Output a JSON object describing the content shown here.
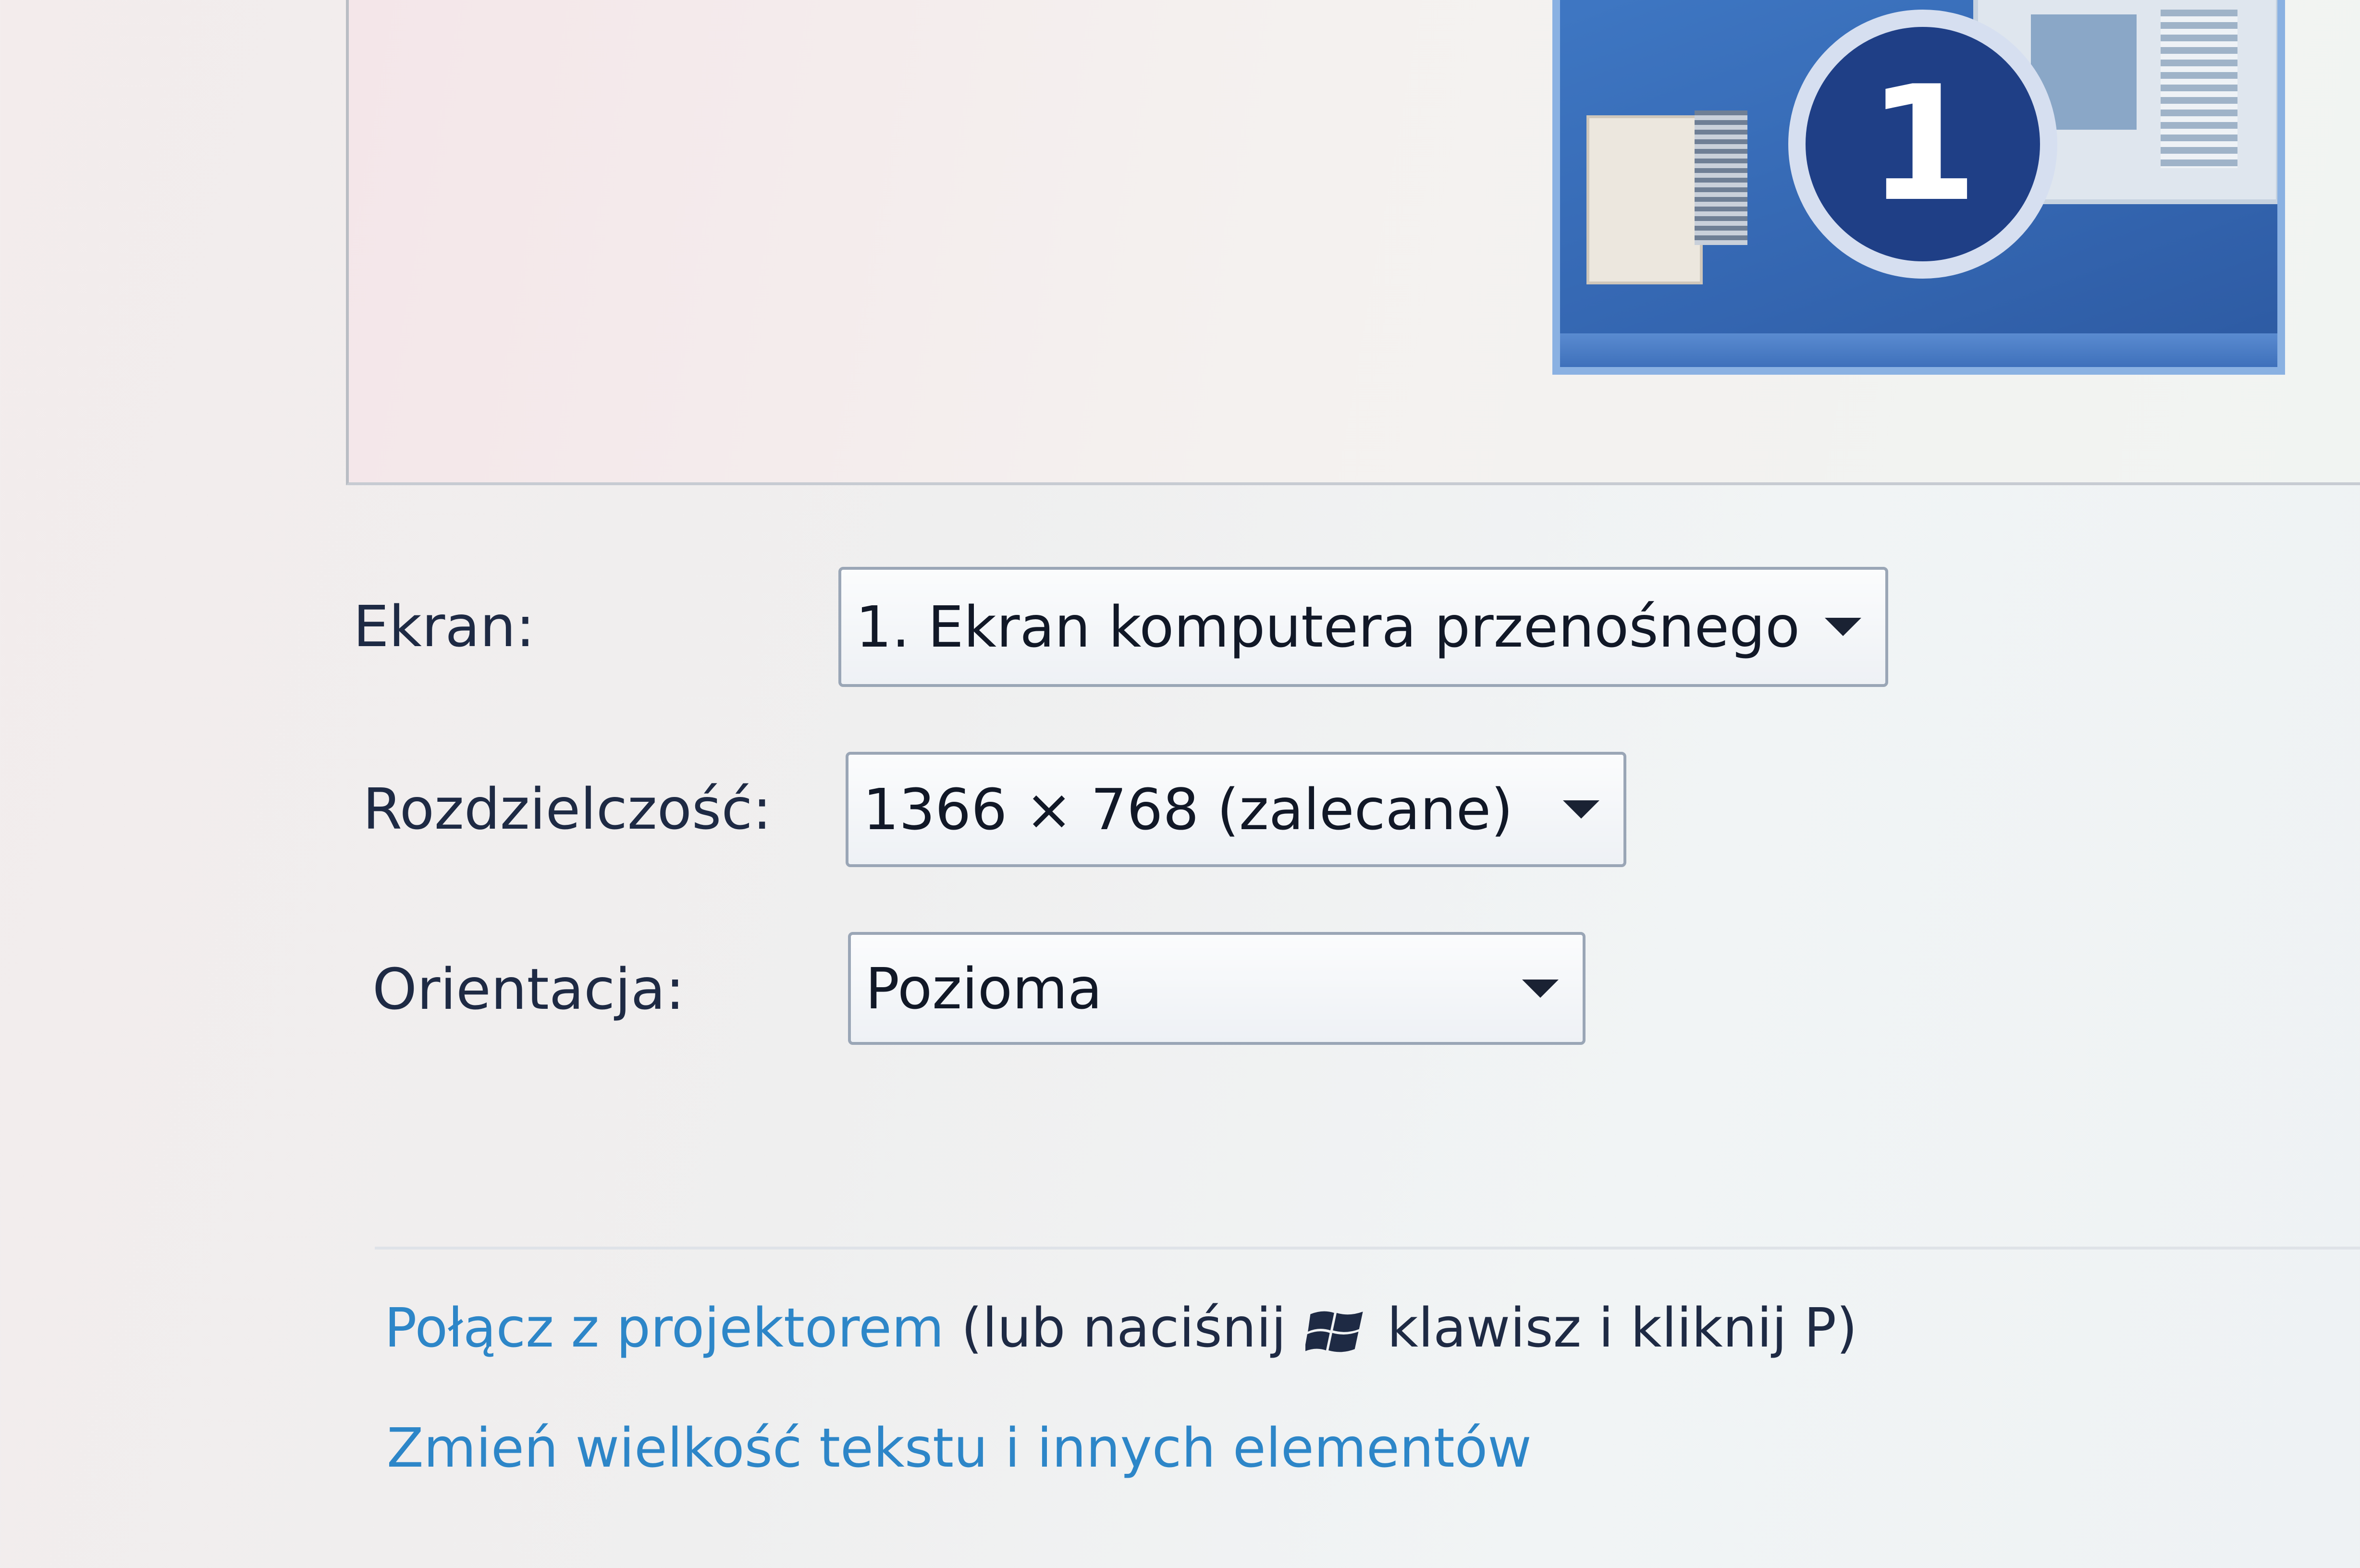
{
  "preview": {
    "selected_display_number": "1"
  },
  "form": {
    "screen_label": "Ekran:",
    "screen_value": "1. Ekran komputera przenośnego",
    "resolution_label": "Rozdzielczość:",
    "resolution_value": "1366 × 768 (zalecane)",
    "orientation_label": "Orientacja:",
    "orientation_value": "Pozioma"
  },
  "links": {
    "projector_link": "Połącz z projektorem",
    "projector_note_before": "(lub naciśnij",
    "projector_note_after": "klawisz i kliknij P)",
    "text_size_link": "Zmień wielkość tekstu i innych elementów"
  },
  "colors": {
    "link": "#2d86c8",
    "label": "#1e2a44",
    "monitor": "#3466b1"
  }
}
